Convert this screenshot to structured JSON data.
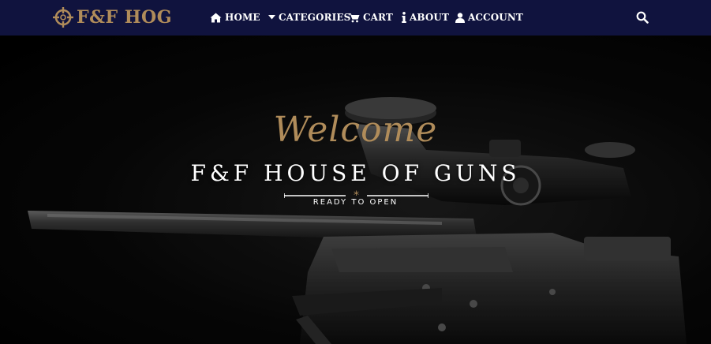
{
  "brand": {
    "name": "F&F HOG"
  },
  "nav": {
    "home": "HOME",
    "categories": "CATEGORIES",
    "cart": "CART",
    "about": "ABOUT",
    "account": "ACCOUNT"
  },
  "hero": {
    "welcome": "Welcome",
    "title": "F&F HOUSE OF GUNS",
    "tagline": "READY TO OPEN"
  },
  "icons": {
    "logo": "crosshair-icon",
    "home": "home-icon",
    "categories": "caret-down-icon",
    "cart": "cart-icon",
    "about": "info-icon",
    "account": "user-icon",
    "search": "search-icon"
  },
  "colors": {
    "navbar": "#10133e",
    "gold": "#b08c5a",
    "text": "#ffffff",
    "background": "#000000"
  }
}
